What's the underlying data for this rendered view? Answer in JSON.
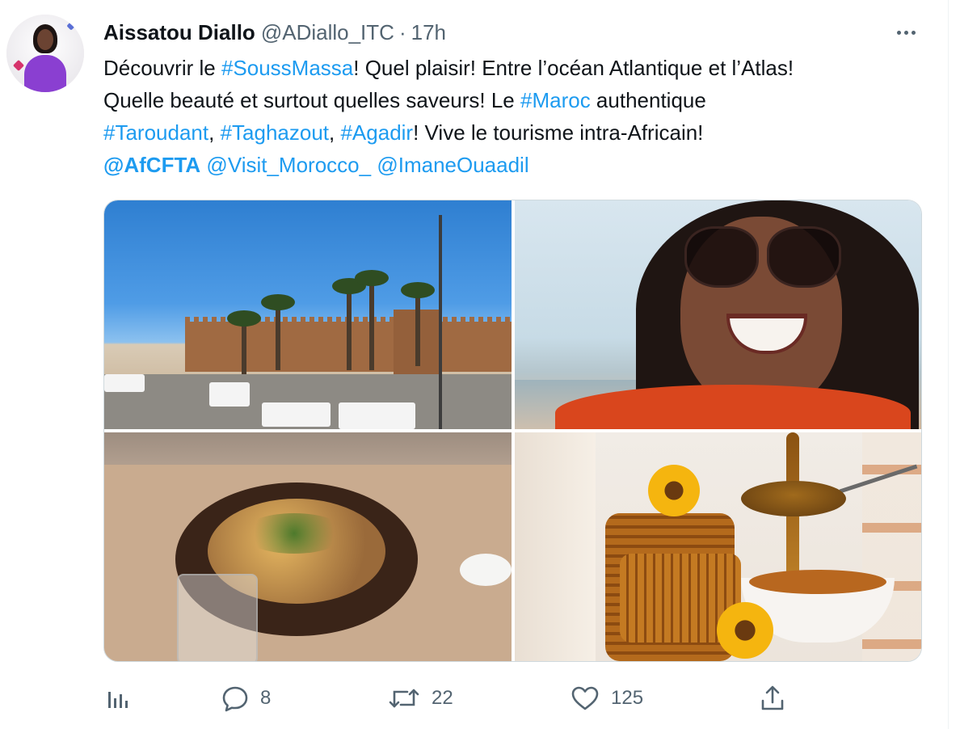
{
  "tweet": {
    "author_name": "Aissatou Diallo",
    "author_handle": "@ADiallo_ITC",
    "separator": "·",
    "time": "17h",
    "text_lines": [
      [
        {
          "t": "Découvrir le ",
          "link": false
        },
        {
          "t": "#SoussMassa",
          "link": true
        },
        {
          "t": "! Quel plaisir! Entre l’océan Atlantique et l’Atlas!",
          "link": false
        }
      ],
      [
        {
          "t": "Quelle beauté et surtout quelles saveurs! Le ",
          "link": false
        },
        {
          "t": "#Maroc",
          "link": true
        },
        {
          "t": " authentique",
          "link": false
        }
      ],
      [
        {
          "t": "#Taroudant",
          "link": true
        },
        {
          "t": ", ",
          "link": false
        },
        {
          "t": "#Taghazout",
          "link": true
        },
        {
          "t": ", ",
          "link": false
        },
        {
          "t": "#Agadir",
          "link": true
        },
        {
          "t": "! Vive le tourisme intra-Africain!",
          "link": false
        }
      ],
      [
        {
          "t": "@AfCFTA",
          "link": true,
          "bold": true
        },
        {
          "t": " ",
          "link": false
        },
        {
          "t": "@Visit_Morocco_",
          "link": true
        },
        {
          "t": " ",
          "link": false
        },
        {
          "t": "@ImaneOuaadil",
          "link": true
        }
      ]
    ]
  },
  "actions": {
    "analytics_icon": "bar-chart-icon",
    "reply_count": "8",
    "retweet_count": "22",
    "like_count": "125",
    "share_icon": "share-icon"
  },
  "colors": {
    "link": "#1d9bf0",
    "text": "#0f1419",
    "muted": "#536471",
    "border": "#cfd9de"
  }
}
